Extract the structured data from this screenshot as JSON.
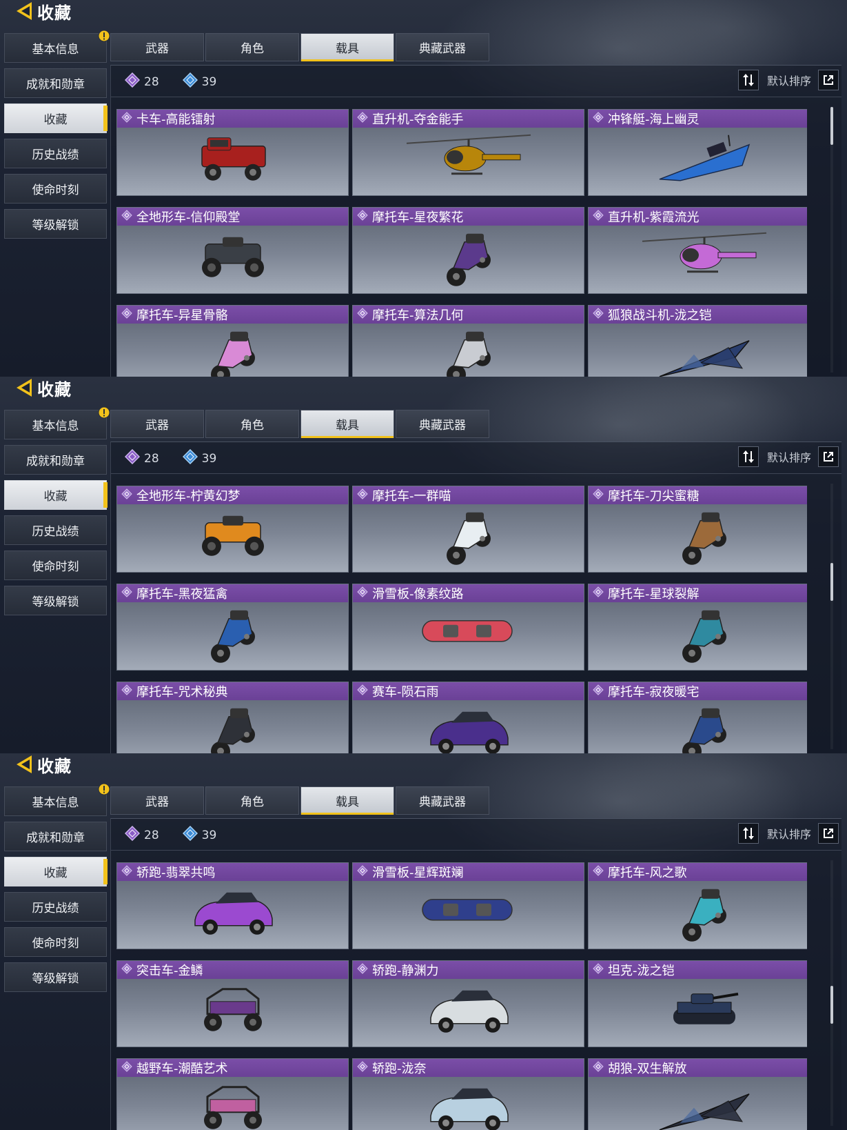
{
  "header": {
    "title": "收藏"
  },
  "sidebar": {
    "items": [
      {
        "label": "基本信息"
      },
      {
        "label": "成就和勋章"
      },
      {
        "label": "收藏"
      },
      {
        "label": "历史战绩"
      },
      {
        "label": "使命时刻"
      },
      {
        "label": "等级解锁"
      }
    ],
    "active_index": 2
  },
  "tabs": [
    {
      "label": "武器"
    },
    {
      "label": "角色"
    },
    {
      "label": "载具"
    },
    {
      "label": "典藏武器"
    }
  ],
  "active_tab": 2,
  "stats": {
    "purple_count": "28",
    "blue_count": "39"
  },
  "sort": {
    "label": "默认排序"
  },
  "colors": {
    "accent": "#f2c21b",
    "card_header": "#6e449c"
  },
  "screens": [
    {
      "scroll_position_fraction": 0.0,
      "cards": [
        {
          "name": "卡车-高能镭射",
          "icon": "truck",
          "color": "#a8201e"
        },
        {
          "name": "直升机-夺金能手",
          "icon": "helicopter",
          "color": "#b8860b"
        },
        {
          "name": "冲锋艇-海上幽灵",
          "icon": "boat",
          "color": "#2a6fd0"
        },
        {
          "name": "全地形车-信仰殿堂",
          "icon": "atv",
          "color": "#3a3f46"
        },
        {
          "name": "摩托车-星夜繁花",
          "icon": "motorcycle",
          "color": "#5b3a8c"
        },
        {
          "name": "直升机-紫霞流光",
          "icon": "helicopter",
          "color": "#c46ad6"
        },
        {
          "name": "摩托车-异星骨骼",
          "icon": "motorcycle",
          "color": "#d98ad6"
        },
        {
          "name": "摩托车-算法几何",
          "icon": "motorcycle",
          "color": "#c9ccd2"
        },
        {
          "name": "狐狼战斗机-泷之铠",
          "icon": "jet",
          "color": "#2a3e6e"
        }
      ]
    },
    {
      "scroll_position_fraction": 0.35,
      "cards": [
        {
          "name": "全地形车-柠黄幻梦",
          "icon": "atv",
          "color": "#e08a1e"
        },
        {
          "name": "摩托车-一群喵",
          "icon": "motorcycle",
          "color": "#e8eef2"
        },
        {
          "name": "摩托车-刀尖蜜糖",
          "icon": "motorcycle",
          "color": "#9c6a3a"
        },
        {
          "name": "摩托车-黑夜猛禽",
          "icon": "motorcycle",
          "color": "#2a5fb0"
        },
        {
          "name": "滑雪板-像素纹路",
          "icon": "snowboard",
          "color": "#d84a5a"
        },
        {
          "name": "摩托车-星球裂解",
          "icon": "motorcycle",
          "color": "#2f8aa0"
        },
        {
          "name": "摩托车-咒术秘典",
          "icon": "motorcycle",
          "color": "#2e3138"
        },
        {
          "name": "赛车-陨石雨",
          "icon": "car",
          "color": "#4a2f8c"
        },
        {
          "name": "摩托车-寂夜暖宅",
          "icon": "motorcycle",
          "color": "#2a4a8c"
        }
      ]
    },
    {
      "scroll_position_fraction": 0.55,
      "cards": [
        {
          "name": "轿跑-翡翠共鸣",
          "icon": "car",
          "color": "#9b4ad0"
        },
        {
          "name": "滑雪板-星辉斑斓",
          "icon": "snowboard",
          "color": "#2f3f8c"
        },
        {
          "name": "摩托车-风之歌",
          "icon": "motorcycle",
          "color": "#3ab0c0"
        },
        {
          "name": "突击车-金鳞",
          "icon": "buggy",
          "color": "#6a3a8c"
        },
        {
          "name": "轿跑-静渊力",
          "icon": "car",
          "color": "#d8dde0"
        },
        {
          "name": "坦克-泷之铠",
          "icon": "tank",
          "color": "#2a3a5a"
        },
        {
          "name": "越野车-潮酷艺术",
          "icon": "buggy",
          "color": "#c060a0"
        },
        {
          "name": "轿跑-泷奈",
          "icon": "car",
          "color": "#b8d0e0"
        },
        {
          "name": "胡狼-双生解放",
          "icon": "jet",
          "color": "#2a2f3e"
        }
      ]
    }
  ]
}
